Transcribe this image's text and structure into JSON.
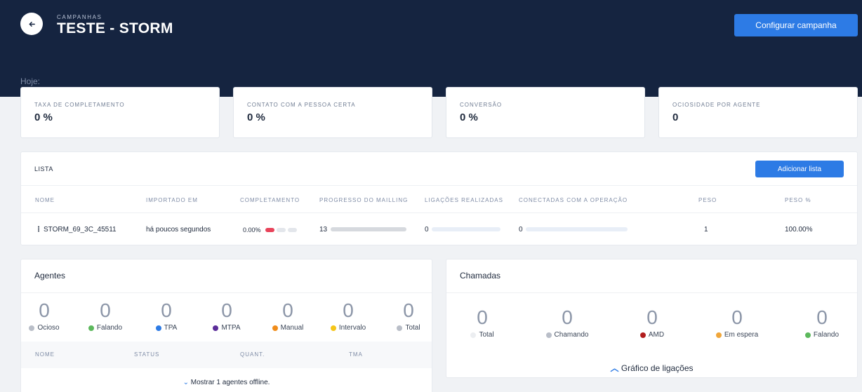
{
  "header": {
    "eyebrow": "CAMPANHAS",
    "title": "TESTE - STORM",
    "config_button": "Configurar campanha",
    "today_label": "Hoje:"
  },
  "kpis": [
    {
      "label": "TAXA DE COMPLETAMENTO",
      "value": "0 %"
    },
    {
      "label": "CONTATO COM A PESSOA CERTA",
      "value": "0 %"
    },
    {
      "label": "CONVERSÃO",
      "value": "0 %"
    },
    {
      "label": "OCIOSIDADE POR AGENTE",
      "value": "0"
    }
  ],
  "lista": {
    "title": "LISTA",
    "add_button": "Adicionar lista",
    "columns": [
      "NOME",
      "IMPORTADO EM",
      "COMPLETAMENTO",
      "PROGRESSO DO MAILLING",
      "LIGAÇÕES REALIZADAS",
      "CONECTADAS COM A OPERAÇÃO",
      "PESO",
      "PESO %"
    ],
    "rows": [
      {
        "menu": "⋮",
        "name": "STORM_69_3C_45511",
        "imported": "há poucos segundos",
        "completion": "0.00%",
        "progress": "13",
        "progress_fraction": 0,
        "calls": "0",
        "calls_fraction": 0,
        "connected": "0",
        "connected_fraction": 0,
        "weight": "1",
        "weight_pct": "100.00%"
      }
    ]
  },
  "agentes": {
    "title": "Agentes",
    "stats": [
      {
        "value": "0",
        "label": "Ocioso",
        "color": "#b9bec8"
      },
      {
        "value": "0",
        "label": "Falando",
        "color": "#5cb85c"
      },
      {
        "value": "0",
        "label": "TPA",
        "color": "#2d7be5"
      },
      {
        "value": "0",
        "label": "MTPA",
        "color": "#5b2d99"
      },
      {
        "value": "0",
        "label": "Manual",
        "color": "#f08c1a"
      },
      {
        "value": "0",
        "label": "Intervalo",
        "color": "#f5c518"
      },
      {
        "value": "0",
        "label": "Total",
        "color": "#b9bec8"
      }
    ],
    "columns": [
      "NOME",
      "STATUS",
      "QUANT.",
      "TMA"
    ],
    "offline_icon": "⌄",
    "offline_link": "Mostrar 1 agentes offline."
  },
  "chamadas": {
    "title": "Chamadas",
    "stats": [
      {
        "value": "0",
        "label": "Total",
        "color": "#eceef1"
      },
      {
        "value": "0",
        "label": "Chamando",
        "color": "#b9bec8"
      },
      {
        "value": "0",
        "label": "AMD",
        "color": "#b11d1d"
      },
      {
        "value": "0",
        "label": "Em espera",
        "color": "#f0a63a"
      },
      {
        "value": "0",
        "label": "Falando",
        "color": "#5cb85c"
      }
    ],
    "graph_icon": "︿",
    "graph_link": "Gráfico de ligações"
  },
  "colors": {
    "accent": "#2d7be5",
    "header_bg": "#152440",
    "completion_pill": "#e8435a"
  }
}
